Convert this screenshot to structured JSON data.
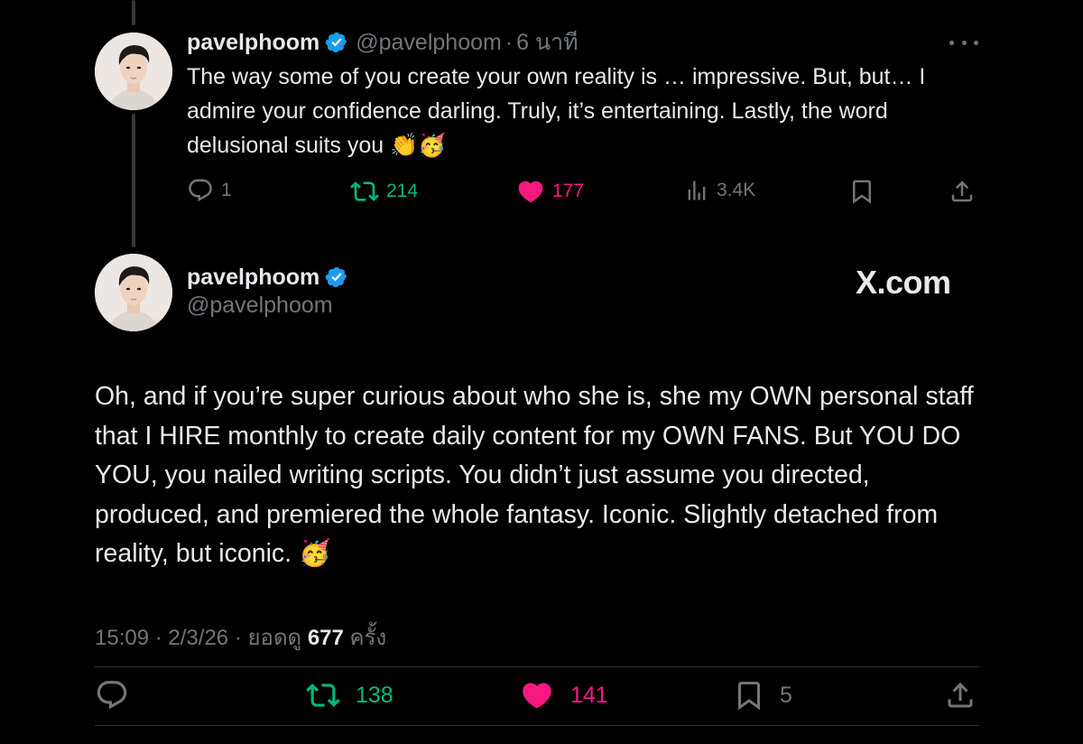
{
  "reply": {
    "display_name": "pavelphoom",
    "handle": "@pavelphoom",
    "separator": "·",
    "time": "6 นาที",
    "text": "The way some of you create your own reality is … impressive. But, but… I admire your confidence darling. Truly, it’s entertaining. Lastly, the word delusional suits you 👏🥳",
    "actions": {
      "replies": "1",
      "reposts": "214",
      "likes": "177",
      "views": "3.4K"
    }
  },
  "main": {
    "display_name": "pavelphoom",
    "handle": "@pavelphoom",
    "watermark": "X.com",
    "text": "Oh, and if you’re super curious about who she is, she my OWN personal staff that I HIRE monthly to create daily content for my OWN FANS. But YOU DO YOU, you nailed writing scripts. You didn’t just assume you directed, produced, and premiered the whole fantasy. Iconic. Slightly detached from reality, but iconic. 🥳",
    "meta": {
      "time": "15:09",
      "date": "2/3/26",
      "views_label": "ยอดดู",
      "views": "677",
      "views_suffix": "ครั้ง"
    },
    "actions": {
      "reposts": "138",
      "likes": "141",
      "bookmarks": "5"
    }
  },
  "colors": {
    "background": "#000000",
    "text": "#e7e9ea",
    "muted": "#71767b",
    "verified": "#1d9bf0",
    "repost": "#00ba7c",
    "like": "#f91880"
  }
}
